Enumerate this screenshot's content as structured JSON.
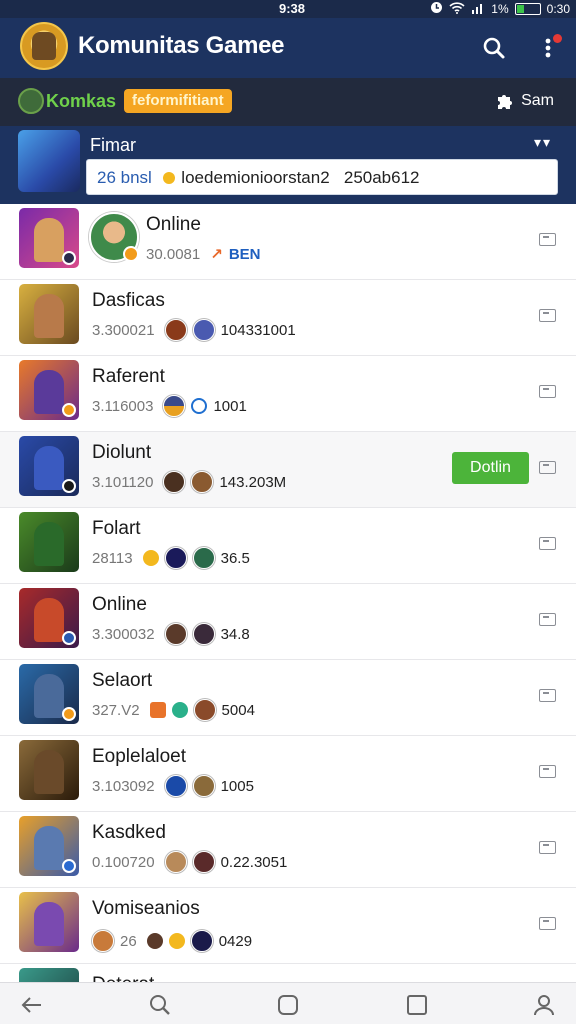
{
  "status_bar": {
    "time": "9:38",
    "battery": "1%",
    "clock_right": "0:30"
  },
  "header": {
    "title": "Komunitas Gamee",
    "icons": [
      "search-icon",
      "more-icon"
    ]
  },
  "banner": {
    "name": "Komkas",
    "pill": "feformifitiant",
    "action": "Sam"
  },
  "featured": {
    "title": "Fimar",
    "count": "26 bnsl",
    "text": "loedemionioorstan2",
    "value": "250ab612"
  },
  "list": [
    {
      "name": "Online",
      "code": "30.0081",
      "tag": "BEN"
    },
    {
      "name": "Dasficas",
      "code": "3.300021",
      "value": "104331001"
    },
    {
      "name": "Raferent",
      "code": "3.116003",
      "value": "1001"
    },
    {
      "name": "Diolunt",
      "code": "3.101120",
      "value": "143.203M",
      "button": "Dotlin"
    },
    {
      "name": "Folart",
      "code": "28113",
      "value": "36.5"
    },
    {
      "name": "Online",
      "code": "3.300032",
      "value": "34.8"
    },
    {
      "name": "Selaort",
      "code": "327.V2",
      "value": "5004"
    },
    {
      "name": "Eoplelaloet",
      "code": "3.103092",
      "value": "1005"
    },
    {
      "name": "Kasdked",
      "code": "0.100720",
      "value": "0.22.3051"
    },
    {
      "name": "Vomiseanios",
      "code": "26",
      "value": "0429"
    },
    {
      "name": "Deterat"
    }
  ],
  "colors": {
    "header": "#1d3360",
    "banner": "#222a3d",
    "accent_green": "#4cb43a",
    "accent_orange": "#f5a623"
  },
  "bottom_nav": [
    "back-icon",
    "search-icon",
    "home-icon",
    "recents-icon",
    "profile-icon"
  ]
}
